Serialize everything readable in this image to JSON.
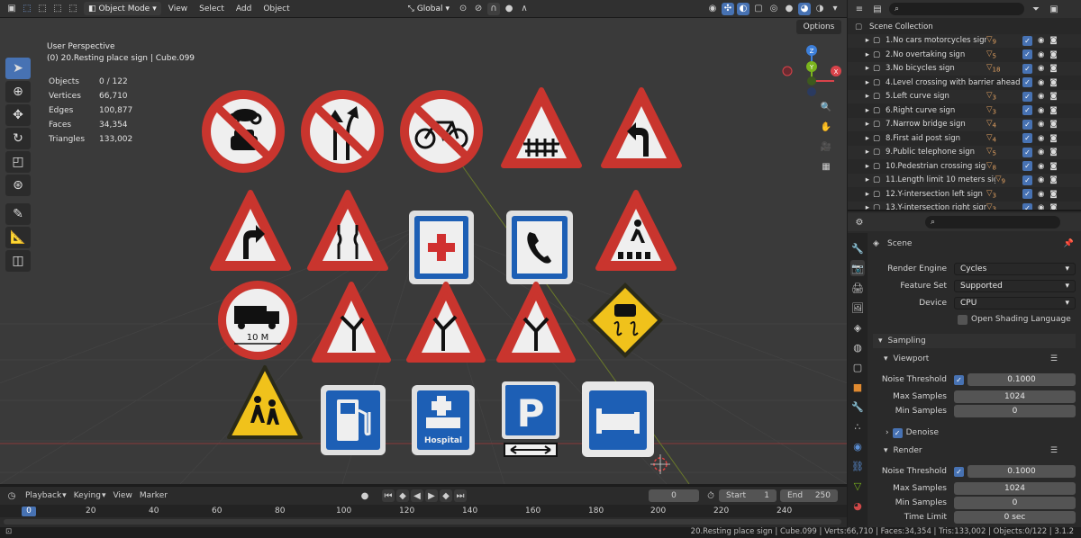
{
  "header": {
    "mode": "Object Mode",
    "menus": [
      "View",
      "Select",
      "Add",
      "Object"
    ],
    "orientation": "Global",
    "options": "Options"
  },
  "viewport": {
    "perspective": "User Perspective",
    "active": "(0) 20.Resting place sign | Cube.099",
    "stats": [
      {
        "label": "Objects",
        "value": "0 / 122"
      },
      {
        "label": "Vertices",
        "value": "66,710"
      },
      {
        "label": "Edges",
        "value": "100,877"
      },
      {
        "label": "Faces",
        "value": "34,354"
      },
      {
        "label": "Triangles",
        "value": "133,002"
      }
    ],
    "gizmo": {
      "x": "X",
      "y": "Y",
      "z": "Z"
    },
    "sign_texts": {
      "truck": "10 M",
      "hospital": "Hospital",
      "parking": "P"
    }
  },
  "outliner": {
    "root": "Scene Collection",
    "items": [
      {
        "label": "1.No cars motorcycles sign",
        "count": "9"
      },
      {
        "label": "2.No overtaking sign",
        "count": "5"
      },
      {
        "label": "3.No bicycles sign",
        "count": "18"
      },
      {
        "label": "4.Level crossing with barrier ahead sign",
        "count": ""
      },
      {
        "label": "5.Left curve sign",
        "count": "3"
      },
      {
        "label": "6.Right curve sign",
        "count": "3"
      },
      {
        "label": "7.Narrow bridge sign",
        "count": "4"
      },
      {
        "label": "8.First aid post sign",
        "count": "4"
      },
      {
        "label": "9.Public telephone sign",
        "count": "5"
      },
      {
        "label": "10.Pedestrian crossing sign",
        "count": "8"
      },
      {
        "label": "11.Length limit 10 meters sign",
        "count": "9"
      },
      {
        "label": "12.Y-intersection left sign",
        "count": "3"
      },
      {
        "label": "13.Y-intersection right sign",
        "count": "3"
      }
    ]
  },
  "properties": {
    "context": "Scene",
    "render_engine_label": "Render Engine",
    "render_engine": "Cycles",
    "feature_set_label": "Feature Set",
    "feature_set": "Supported",
    "device_label": "Device",
    "device": "CPU",
    "osl_label": "Open Shading Language",
    "sampling": "Sampling",
    "viewport": "Viewport",
    "noise_threshold_label": "Noise Threshold",
    "viewport_noise": "0.1000",
    "max_samples_label": "Max Samples",
    "viewport_max": "1024",
    "min_samples_label": "Min Samples",
    "viewport_min": "0",
    "denoise": "Denoise",
    "render": "Render",
    "render_noise": "0.1000",
    "render_max": "1024",
    "render_min": "0",
    "time_limit_label": "Time Limit",
    "time_limit": "0 sec"
  },
  "timeline": {
    "menus": [
      "Playback",
      "Keying",
      "View",
      "Marker"
    ],
    "current": "0",
    "start_label": "Start",
    "start": "1",
    "end_label": "End",
    "end": "250",
    "ticks": [
      "0",
      "20",
      "40",
      "60",
      "80",
      "100",
      "120",
      "140",
      "160",
      "180",
      "200",
      "220",
      "240"
    ]
  },
  "status": "20.Resting place sign | Cube.099 | Verts:66,710 | Faces:34,354 | Tris:133,002 | Objects:0/122 | 3.1.2",
  "colors": {
    "accent": "#4772b3",
    "sign_red": "#d63a32",
    "sign_blue": "#1d5fb5",
    "sign_yellow": "#f0c21b"
  }
}
